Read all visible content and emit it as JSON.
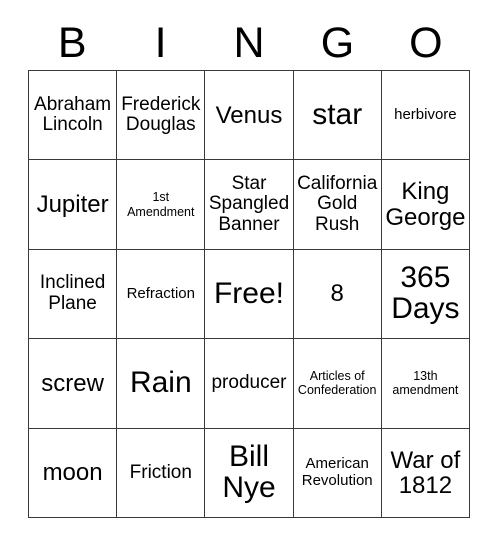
{
  "card": {
    "title": "BINGO",
    "header_letters": [
      "B",
      "I",
      "N",
      "G",
      "O"
    ],
    "columns": 5,
    "rows": 5,
    "border_color": "#3a3a3a",
    "background_color": "#ffffff",
    "text_color": "#000000",
    "free_space_label": "Free!",
    "free_space_position": "row 3, column 3"
  },
  "grid": {
    "rows": [
      {
        "cells": [
          {
            "text": "Abraham Lincoln",
            "size": "m"
          },
          {
            "text": "Frederick Douglas",
            "size": "m"
          },
          {
            "text": "Venus",
            "size": "l"
          },
          {
            "text": "star",
            "size": "xl"
          },
          {
            "text": "herbivore",
            "size": "s"
          }
        ]
      },
      {
        "cells": [
          {
            "text": "Jupiter",
            "size": "l"
          },
          {
            "text": "1st Amendment",
            "size": "xs"
          },
          {
            "text": "Star Spangled Banner",
            "size": "m"
          },
          {
            "text": "California Gold Rush",
            "size": "m"
          },
          {
            "text": "King George",
            "size": "l"
          }
        ]
      },
      {
        "cells": [
          {
            "text": "Inclined Plane",
            "size": "m"
          },
          {
            "text": "Refraction",
            "size": "s"
          },
          {
            "text": "Free!",
            "size": "xl"
          },
          {
            "text": "8",
            "size": "l"
          },
          {
            "text": "365 Days",
            "size": "xl"
          }
        ]
      },
      {
        "cells": [
          {
            "text": "screw",
            "size": "l"
          },
          {
            "text": "Rain",
            "size": "xl"
          },
          {
            "text": "producer",
            "size": "m"
          },
          {
            "text": "Articles of Confederation",
            "size": "xs"
          },
          {
            "text": "13th amendment",
            "size": "xs"
          }
        ]
      },
      {
        "cells": [
          {
            "text": "moon",
            "size": "l"
          },
          {
            "text": "Friction",
            "size": "m"
          },
          {
            "text": "Bill Nye",
            "size": "xl"
          },
          {
            "text": "American Revolution",
            "size": "s"
          },
          {
            "text": "War of 1812",
            "size": "l"
          }
        ]
      }
    ]
  }
}
